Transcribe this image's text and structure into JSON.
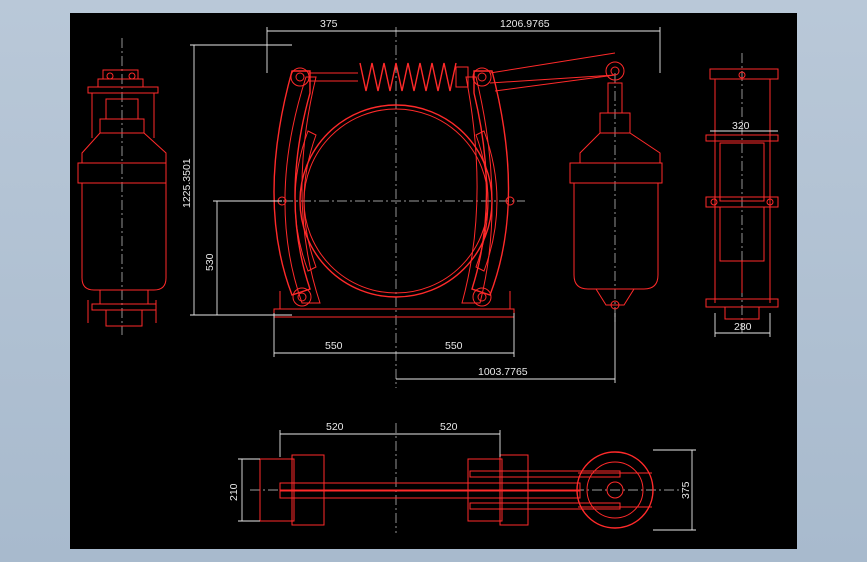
{
  "colors": {
    "background": "#b9c8d8",
    "viewport": "#000000",
    "geometry": "#ff2a2a",
    "dimension": "#e8e8e8",
    "centerline": "#d0d0d0"
  },
  "dimensions": {
    "front_top_left": "375",
    "front_top_right": "1206.9765",
    "front_height_total": "1225.3501",
    "front_height_axis": "530",
    "front_base_left": "550",
    "front_base_right": "550",
    "front_thruster_offset": "1003.7765",
    "side_top_width": "320",
    "side_base_width": "280",
    "plan_left": "520",
    "plan_right": "520",
    "plan_shoe_width": "210",
    "plan_arm_width": "375"
  }
}
